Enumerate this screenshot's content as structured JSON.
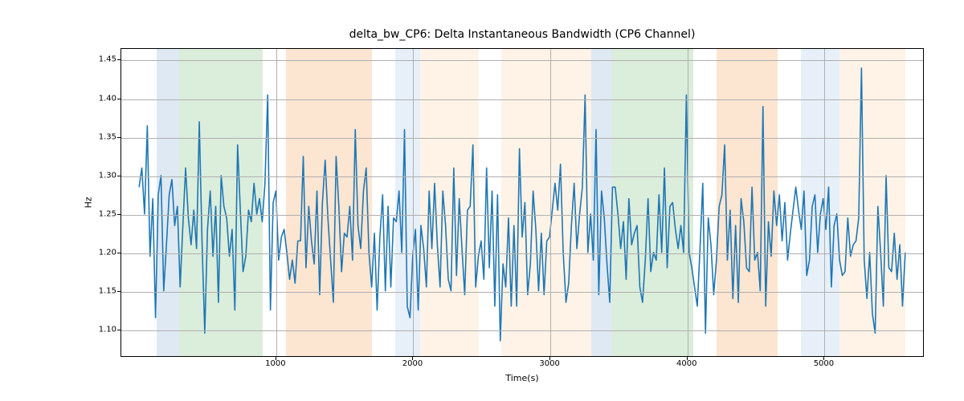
{
  "chart_data": {
    "type": "line",
    "title": "delta_bw_CP6: Delta Instantaneous Bandwidth (CP6 Channel)",
    "xlabel": "Time(s)",
    "ylabel": "Hz",
    "xlim": [
      -130,
      5730
    ],
    "ylim": [
      1.065,
      1.465
    ],
    "xticks": [
      1000,
      2000,
      3000,
      4000,
      5000
    ],
    "yticks": [
      1.1,
      1.15,
      1.2,
      1.25,
      1.3,
      1.35,
      1.4,
      1.45
    ],
    "line_color": "#1f77b4",
    "bands": [
      {
        "x0": 130,
        "x1": 290,
        "color": "#88b1d4"
      },
      {
        "x0": 290,
        "x1": 900,
        "color": "#7fc07f"
      },
      {
        "x0": 1070,
        "x1": 1700,
        "color": "#f5a35b"
      },
      {
        "x0": 1870,
        "x1": 2050,
        "color": "#a9c5e8"
      },
      {
        "x0": 2050,
        "x1": 2480,
        "color": "#fbd3a5"
      },
      {
        "x0": 2640,
        "x1": 3300,
        "color": "#fbd3a5"
      },
      {
        "x0": 3300,
        "x1": 3450,
        "color": "#88b1d4"
      },
      {
        "x0": 3450,
        "x1": 4040,
        "color": "#7fc07f"
      },
      {
        "x0": 4210,
        "x1": 4660,
        "color": "#f5a35b"
      },
      {
        "x0": 4830,
        "x1": 5110,
        "color": "#a9c5e8"
      },
      {
        "x0": 5110,
        "x1": 5590,
        "color": "#fbd3a5"
      }
    ],
    "x": [
      0,
      20,
      40,
      60,
      80,
      100,
      120,
      140,
      160,
      180,
      200,
      220,
      240,
      260,
      280,
      300,
      320,
      340,
      360,
      380,
      400,
      420,
      440,
      460,
      480,
      500,
      520,
      540,
      560,
      580,
      600,
      620,
      640,
      660,
      680,
      700,
      720,
      740,
      760,
      780,
      800,
      820,
      840,
      860,
      880,
      900,
      920,
      940,
      960,
      980,
      1000,
      1020,
      1040,
      1060,
      1080,
      1100,
      1120,
      1140,
      1160,
      1180,
      1200,
      1220,
      1240,
      1260,
      1280,
      1300,
      1320,
      1340,
      1360,
      1380,
      1400,
      1420,
      1440,
      1460,
      1480,
      1500,
      1520,
      1540,
      1560,
      1580,
      1600,
      1620,
      1640,
      1660,
      1680,
      1700,
      1720,
      1740,
      1760,
      1780,
      1800,
      1820,
      1840,
      1860,
      1880,
      1900,
      1920,
      1940,
      1960,
      1980,
      2000,
      2020,
      2040,
      2060,
      2080,
      2100,
      2120,
      2140,
      2160,
      2180,
      2200,
      2220,
      2240,
      2260,
      2280,
      2300,
      2320,
      2340,
      2360,
      2380,
      2400,
      2420,
      2440,
      2460,
      2480,
      2500,
      2520,
      2540,
      2560,
      2580,
      2600,
      2620,
      2640,
      2660,
      2680,
      2700,
      2720,
      2740,
      2760,
      2780,
      2800,
      2820,
      2840,
      2860,
      2880,
      2900,
      2920,
      2940,
      2960,
      2980,
      3000,
      3020,
      3040,
      3060,
      3080,
      3100,
      3120,
      3140,
      3160,
      3180,
      3200,
      3220,
      3240,
      3260,
      3280,
      3300,
      3320,
      3340,
      3360,
      3380,
      3400,
      3420,
      3440,
      3460,
      3480,
      3500,
      3520,
      3540,
      3560,
      3580,
      3600,
      3620,
      3640,
      3660,
      3680,
      3700,
      3720,
      3740,
      3760,
      3780,
      3800,
      3820,
      3840,
      3860,
      3880,
      3900,
      3920,
      3940,
      3960,
      3980,
      4000,
      4020,
      4040,
      4060,
      4080,
      4100,
      4120,
      4140,
      4160,
      4180,
      4200,
      4220,
      4240,
      4260,
      4280,
      4300,
      4320,
      4340,
      4360,
      4380,
      4400,
      4420,
      4440,
      4460,
      4480,
      4500,
      4520,
      4540,
      4560,
      4580,
      4600,
      4620,
      4640,
      4660,
      4680,
      4700,
      4720,
      4740,
      4760,
      4780,
      4800,
      4820,
      4840,
      4860,
      4880,
      4900,
      4920,
      4940,
      4960,
      4980,
      5000,
      5020,
      5040,
      5060,
      5080,
      5100,
      5120,
      5140,
      5160,
      5180,
      5200,
      5220,
      5240,
      5260,
      5280,
      5300,
      5320,
      5340,
      5360,
      5380,
      5400,
      5420,
      5440,
      5460,
      5480,
      5500,
      5520,
      5540,
      5560,
      5580,
      5600
    ],
    "y": [
      1.285,
      1.31,
      1.25,
      1.365,
      1.195,
      1.27,
      1.115,
      1.275,
      1.3,
      1.15,
      1.21,
      1.275,
      1.295,
      1.235,
      1.26,
      1.155,
      1.235,
      1.31,
      1.245,
      1.21,
      1.255,
      1.205,
      1.37,
      1.215,
      1.095,
      1.23,
      1.28,
      1.195,
      1.26,
      1.135,
      1.3,
      1.26,
      1.245,
      1.195,
      1.23,
      1.125,
      1.34,
      1.255,
      1.175,
      1.195,
      1.255,
      1.24,
      1.29,
      1.25,
      1.27,
      1.24,
      1.29,
      1.405,
      1.125,
      1.265,
      1.28,
      1.19,
      1.22,
      1.23,
      1.2,
      1.165,
      1.19,
      1.16,
      1.215,
      1.215,
      1.325,
      1.18,
      1.26,
      1.215,
      1.185,
      1.28,
      1.145,
      1.265,
      1.32,
      1.245,
      1.19,
      1.135,
      1.325,
      1.26,
      1.175,
      1.225,
      1.22,
      1.26,
      1.19,
      1.36,
      1.235,
      1.205,
      1.28,
      1.31,
      1.2,
      1.155,
      1.225,
      1.125,
      1.22,
      1.275,
      1.15,
      1.26,
      1.155,
      1.245,
      1.24,
      1.28,
      1.2,
      1.36,
      1.13,
      1.115,
      1.195,
      1.23,
      1.125,
      1.235,
      1.205,
      1.155,
      1.28,
      1.205,
      1.29,
      1.21,
      1.155,
      1.28,
      1.235,
      1.165,
      1.15,
      1.31,
      1.17,
      1.27,
      1.205,
      1.145,
      1.255,
      1.26,
      1.34,
      1.155,
      1.195,
      1.215,
      1.165,
      1.31,
      1.18,
      1.28,
      1.13,
      1.275,
      1.085,
      1.185,
      1.155,
      1.245,
      1.13,
      1.235,
      1.13,
      1.335,
      1.22,
      1.265,
      1.145,
      1.185,
      1.28,
      1.23,
      1.15,
      1.225,
      1.145,
      1.215,
      1.22,
      1.255,
      1.29,
      1.255,
      1.315,
      1.2,
      1.135,
      1.16,
      1.235,
      1.29,
      1.205,
      1.25,
      1.285,
      1.405,
      1.2,
      1.25,
      1.19,
      1.36,
      1.145,
      1.28,
      1.245,
      1.185,
      1.135,
      1.285,
      1.285,
      1.25,
      1.205,
      1.24,
      1.165,
      1.27,
      1.21,
      1.225,
      1.235,
      1.155,
      1.135,
      1.19,
      1.27,
      1.175,
      1.2,
      1.19,
      1.275,
      1.2,
      1.31,
      1.18,
      1.26,
      1.265,
      1.23,
      1.205,
      1.235,
      1.2,
      1.405,
      1.2,
      1.18,
      1.155,
      1.13,
      1.205,
      1.29,
      1.095,
      1.245,
      1.21,
      1.145,
      1.19,
      1.26,
      1.275,
      1.34,
      1.19,
      1.255,
      1.14,
      1.235,
      1.135,
      1.27,
      1.24,
      1.18,
      1.175,
      1.285,
      1.19,
      1.2,
      1.15,
      1.39,
      1.13,
      1.24,
      1.195,
      1.28,
      1.235,
      1.275,
      1.215,
      1.265,
      1.19,
      1.225,
      1.255,
      1.285,
      1.255,
      1.23,
      1.28,
      1.17,
      1.19,
      1.26,
      1.275,
      1.2,
      1.25,
      1.27,
      1.23,
      1.285,
      1.155,
      1.235,
      1.25,
      1.19,
      1.17,
      1.175,
      1.245,
      1.195,
      1.21,
      1.215,
      1.245,
      1.44,
      1.19,
      1.14,
      1.2,
      1.12,
      1.095,
      1.26,
      1.2,
      1.13,
      1.3,
      1.18,
      1.175,
      1.225,
      1.165,
      1.21,
      1.13,
      1.2
    ]
  }
}
